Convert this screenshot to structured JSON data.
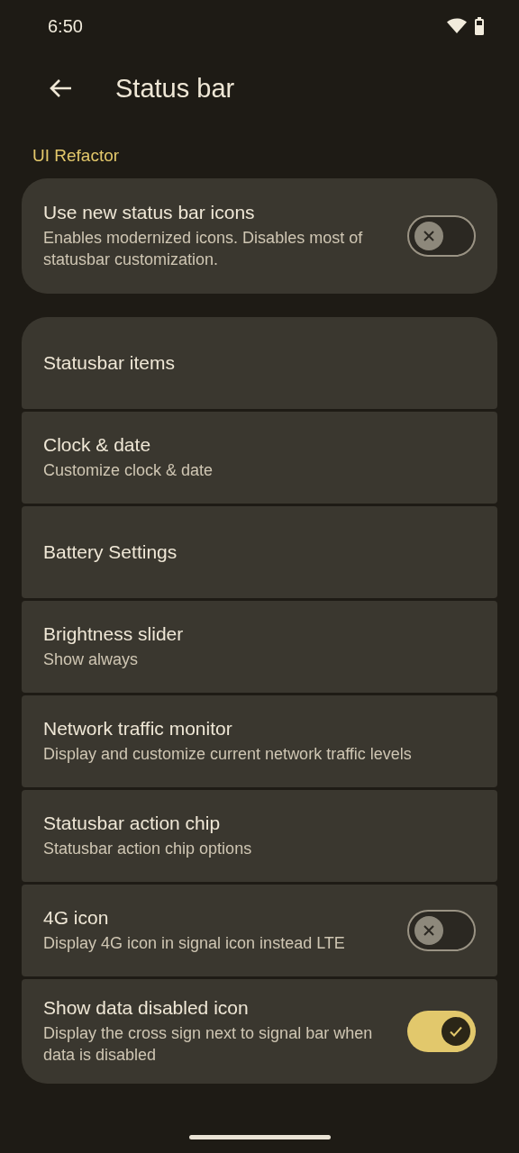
{
  "status_bar": {
    "time": "6:50"
  },
  "header": {
    "title": "Status bar"
  },
  "section": {
    "label": "UI Refactor"
  },
  "feature_card": {
    "title": "Use new status bar icons",
    "summary": "Enables modernized icons. Disables most of statusbar customization.",
    "kind": "toggle",
    "on": false
  },
  "items": [
    {
      "kind": "link",
      "title": "Statusbar items"
    },
    {
      "kind": "link",
      "title": "Clock & date",
      "summary": "Customize clock & date"
    },
    {
      "kind": "link",
      "title": "Battery Settings"
    },
    {
      "kind": "link",
      "title": "Brightness slider",
      "summary": "Show always"
    },
    {
      "kind": "link",
      "title": "Network traffic monitor",
      "summary": "Display and customize current network traffic levels"
    },
    {
      "kind": "link",
      "title": "Statusbar action chip",
      "summary": "Statusbar action chip options"
    },
    {
      "kind": "toggle",
      "title": "4G icon",
      "summary": "Display 4G icon in signal icon instead LTE",
      "on": false
    },
    {
      "kind": "toggle",
      "title": "Show data disabled icon",
      "summary": "Display the cross sign next to signal bar when data is disabled",
      "on": true
    }
  ]
}
